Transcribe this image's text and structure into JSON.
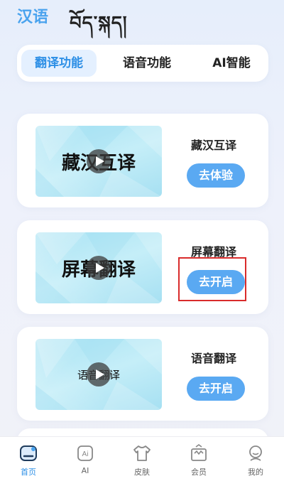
{
  "header": {
    "lang_zh": "汉语",
    "lang_bo": "བོད་སྐད།"
  },
  "tabs": [
    {
      "label": "翻译功能",
      "active": true
    },
    {
      "label": "语音功能",
      "active": false
    },
    {
      "label": "AI智能",
      "active": false
    }
  ],
  "cards": [
    {
      "thumb_text": "藏汉互译",
      "title": "藏汉互译",
      "button": "去体验"
    },
    {
      "thumb_text": "屏幕翻译",
      "title": "屏幕翻译",
      "button": "去开启"
    },
    {
      "thumb_text": "语音翻译",
      "title": "语音翻译",
      "button": "去开启"
    }
  ],
  "nav": [
    {
      "label": "首页",
      "icon": "home-icon",
      "active": true
    },
    {
      "label": "AI",
      "icon": "ai-icon",
      "active": false
    },
    {
      "label": "皮肤",
      "icon": "shirt-icon",
      "active": false
    },
    {
      "label": "会员",
      "icon": "crown-icon",
      "active": false
    },
    {
      "label": "我的",
      "icon": "profile-icon",
      "active": false
    }
  ],
  "colors": {
    "accent": "#4aa3ee",
    "button": "#5aa9f2",
    "active_tab_bg": "#e4f0ff",
    "highlight": "#d92b2b"
  }
}
